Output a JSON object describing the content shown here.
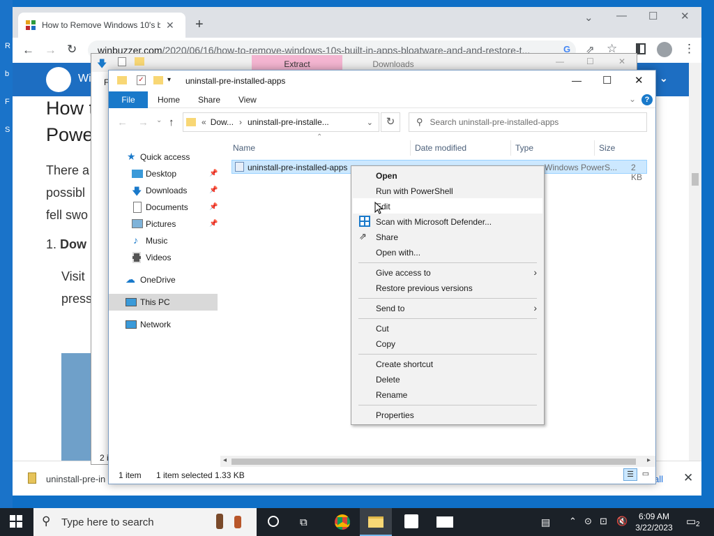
{
  "desktop": {
    "glyphs": [
      "R",
      "b",
      "F",
      "S"
    ]
  },
  "chrome": {
    "tab_title": "How to Remove Windows 10's b",
    "url_host": "winbuzzer.com",
    "url_path": "/2020/06/16/how-to-remove-windows-10s-built-in-apps-bloatware-and-and-restore-t...",
    "site_brand": "Wi",
    "site_heading_line1": "How t",
    "site_heading_line2": "Powe",
    "site_para_line1": "There a",
    "site_para_line2": "possibl",
    "site_para_line3": "fell swo",
    "site_step_num": "1.",
    "site_step_bold": "Dow",
    "site_step_line1": "Visit",
    "site_step_line2": "press",
    "download_file": "uninstall-pre-in",
    "download_all_btn": "all"
  },
  "explorer_bg": {
    "extract_tab": "Extract",
    "downloads_tab": "Downloads",
    "ribbon_f": "F",
    "status_count": "2 i"
  },
  "explorer": {
    "title": "uninstall-pre-installed-apps",
    "ribbon": {
      "file": "File",
      "home": "Home",
      "share": "Share",
      "view": "View"
    },
    "help": "?",
    "address": {
      "prefix": "«",
      "crumb1": "Dow...",
      "crumb2": "uninstall-pre-installe..."
    },
    "search_placeholder": "Search uninstall-pre-installed-apps",
    "nav": {
      "quick_access": "Quick access",
      "desktop": "Desktop",
      "downloads": "Downloads",
      "documents": "Documents",
      "pictures": "Pictures",
      "music": "Music",
      "videos": "Videos",
      "onedrive": "OneDrive",
      "this_pc": "This PC",
      "network": "Network"
    },
    "columns": {
      "name": "Name",
      "date_modified": "Date modified",
      "type": "Type",
      "size": "Size"
    },
    "file": {
      "name": "uninstall-pre-installed-apps",
      "type": "Windows PowerS...",
      "size": "2 KB"
    },
    "status": {
      "items": "1 item",
      "selected": "1 item selected  1.33 KB"
    }
  },
  "context_menu": {
    "open": "Open",
    "run_ps": "Run with PowerShell",
    "edit": "Edit",
    "scan": "Scan with Microsoft Defender...",
    "share": "Share",
    "open_with": "Open with...",
    "give_access": "Give access to",
    "restore": "Restore previous versions",
    "send_to": "Send to",
    "cut": "Cut",
    "copy": "Copy",
    "create_shortcut": "Create shortcut",
    "delete": "Delete",
    "rename": "Rename",
    "properties": "Properties"
  },
  "taskbar": {
    "search_placeholder": "Type here to search",
    "time": "6:09 AM",
    "date": "3/22/2023",
    "notification_count": "2"
  },
  "colors": {
    "accent": "#1979ca",
    "selection": "#cce8ff",
    "taskbar": "#1b2128"
  }
}
